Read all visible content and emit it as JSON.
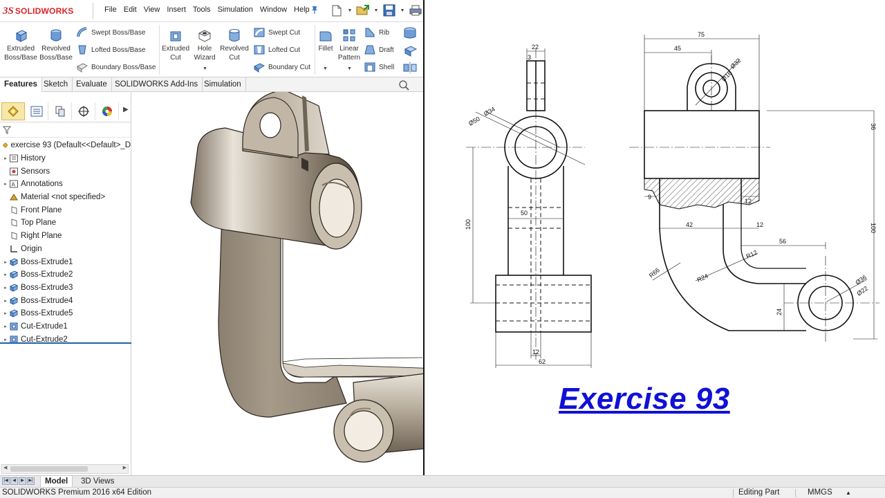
{
  "app": {
    "brand_prefix": "3S",
    "brand_name": "SOLIDWORKS"
  },
  "menu": [
    "File",
    "Edit",
    "View",
    "Insert",
    "Tools",
    "Simulation",
    "Window",
    "Help"
  ],
  "quick_access": {
    "icons": [
      "new-document-icon",
      "open-icon",
      "save-icon",
      "print-icon"
    ]
  },
  "ribbon": {
    "extruded_boss": "Extruded Boss/Base",
    "revolved_boss": "Revolved Boss/Base",
    "swept_boss": "Swept Boss/Base",
    "lofted_boss": "Lofted Boss/Base",
    "boundary_boss": "Boundary Boss/Base",
    "extruded_cut": "Extruded Cut",
    "hole_wizard": "Hole Wizard",
    "revolved_cut": "Revolved Cut",
    "swept_cut": "Swept Cut",
    "lofted_cut": "Lofted Cut",
    "boundary_cut": "Boundary Cut",
    "fillet": "Fillet",
    "linear_pattern": "Linear Pattern",
    "rib": "Rib",
    "draft": "Draft",
    "shell": "Shell"
  },
  "tabs": [
    "Features",
    "Sketch",
    "Evaluate",
    "SOLIDWORKS Add-Ins",
    "Simulation"
  ],
  "tree": {
    "root": "exercise 93  (Default<<Default>_D",
    "items": [
      {
        "label": "History",
        "expandable": true
      },
      {
        "label": "Sensors",
        "expandable": false
      },
      {
        "label": "Annotations",
        "expandable": true
      },
      {
        "label": "Material <not specified>",
        "expandable": false
      },
      {
        "label": "Front Plane",
        "expandable": false
      },
      {
        "label": "Top Plane",
        "expandable": false
      },
      {
        "label": "Right Plane",
        "expandable": false
      },
      {
        "label": "Origin",
        "expandable": false
      },
      {
        "label": "Boss-Extrude1",
        "expandable": true
      },
      {
        "label": "Boss-Extrude2",
        "expandable": true
      },
      {
        "label": "Boss-Extrude3",
        "expandable": true
      },
      {
        "label": "Boss-Extrude4",
        "expandable": true
      },
      {
        "label": "Boss-Extrude5",
        "expandable": true
      },
      {
        "label": "Cut-Extrude1",
        "expandable": true
      },
      {
        "label": "Cut-Extrude2",
        "expandable": true
      }
    ]
  },
  "drawing": {
    "title": "Exercise 93",
    "dims": {
      "d22": "22",
      "d3": "3",
      "d34": "Ø34",
      "d50d": "Ø50",
      "d50": "50",
      "d100l": "100",
      "d12b": "12",
      "d62": "62",
      "d75": "75",
      "d45": "45",
      "d32": "Ø32",
      "d16": "Ø16",
      "d36": "36",
      "d9": "9",
      "d12r": "12",
      "d42": "42",
      "d12m": "12",
      "d100r": "100",
      "d56": "56",
      "r12": "R12",
      "r66": "R66",
      "r24": "R24",
      "d36b": "Ø36",
      "d22b": "Ø22",
      "d24": "24"
    }
  },
  "bottom_tabs": {
    "model": "Model",
    "views3d": "3D Views"
  },
  "status": {
    "edition": "SOLIDWORKS Premium 2016 x64 Edition",
    "mode": "Editing Part",
    "units": "MMGS",
    "caret": "▲"
  }
}
